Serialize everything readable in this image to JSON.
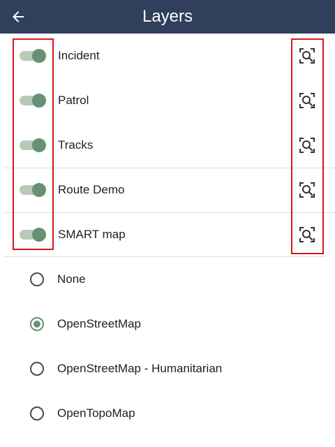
{
  "header": {
    "title": "Layers",
    "back_icon": "arrow-left-icon",
    "background": "#2f3f5c"
  },
  "layers": [
    {
      "label": "Incident",
      "enabled": true,
      "action_icon": "zoom-to-layer-icon"
    },
    {
      "label": "Patrol",
      "enabled": true,
      "action_icon": "zoom-to-layer-icon"
    },
    {
      "label": "Tracks",
      "enabled": true,
      "action_icon": "zoom-to-layer-icon"
    },
    {
      "label": "Route Demo",
      "enabled": true,
      "action_icon": "zoom-to-layer-icon"
    },
    {
      "label": "SMART map",
      "enabled": true,
      "action_icon": "zoom-to-layer-icon"
    }
  ],
  "basemaps": {
    "selected": "OpenStreetMap",
    "options": [
      "None",
      "OpenStreetMap",
      "OpenStreetMap - Humanitarian",
      "OpenTopoMap"
    ]
  },
  "colors": {
    "accent": "#669174",
    "toggle_track": "#b6cab8",
    "highlight": "#d9161c"
  }
}
